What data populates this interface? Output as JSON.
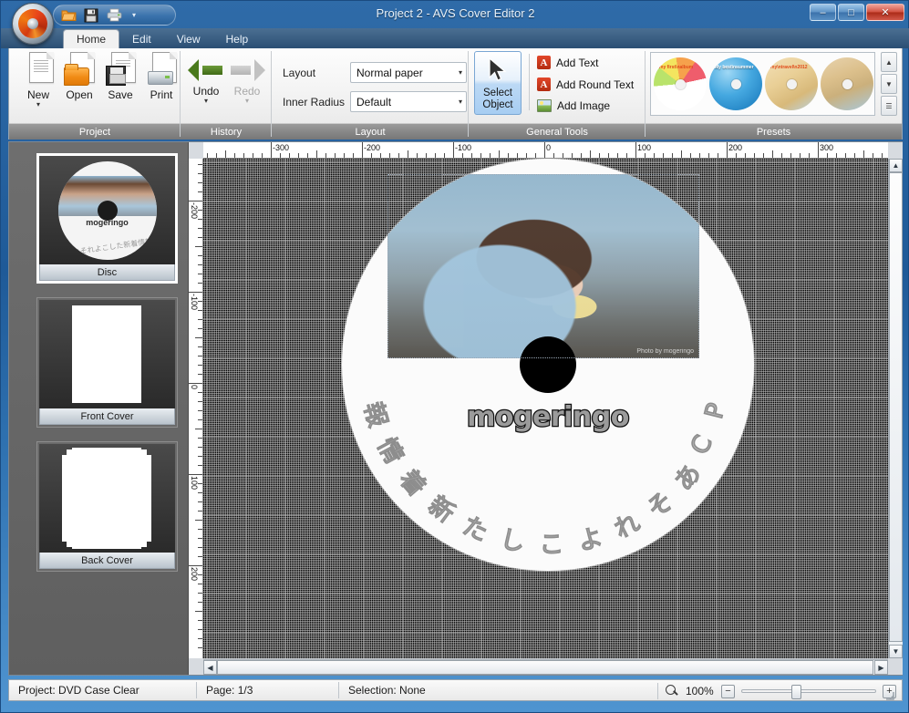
{
  "window": {
    "title": "Project 2 - AVS Cover Editor 2",
    "minimize_label": "–",
    "maximize_label": "□",
    "close_label": "✕",
    "qat_dropdown_label": "▾"
  },
  "quick_access": [
    {
      "name": "open-icon",
      "label": "Open"
    },
    {
      "name": "save-icon",
      "label": "Save"
    },
    {
      "name": "print-icon",
      "label": "Print"
    }
  ],
  "tabs": [
    {
      "label": "Home",
      "active": true
    },
    {
      "label": "Edit",
      "active": false
    },
    {
      "label": "View",
      "active": false
    },
    {
      "label": "Help",
      "active": false
    }
  ],
  "ribbon": {
    "groups": {
      "project": {
        "caption": "Project",
        "buttons": [
          {
            "label": "New",
            "caret": "▾",
            "enabled": true
          },
          {
            "label": "Open",
            "caret": "",
            "enabled": true
          },
          {
            "label": "Save",
            "caret": "",
            "enabled": true
          },
          {
            "label": "Print",
            "caret": "",
            "enabled": true
          }
        ]
      },
      "history": {
        "caption": "History",
        "buttons": [
          {
            "label": "Undo",
            "caret": "▾",
            "enabled": true
          },
          {
            "label": "Redo",
            "caret": "▾",
            "enabled": false
          }
        ]
      },
      "layout": {
        "caption": "Layout",
        "fields": [
          {
            "label": "Layout",
            "value": "Normal paper",
            "caret": "▾"
          },
          {
            "label": "Inner Radius",
            "value": "Default",
            "caret": "▾"
          }
        ]
      },
      "general_tools": {
        "caption": "General Tools",
        "select_object_label": "Select\nObject",
        "select_object_line1": "Select",
        "select_object_line2": "Object",
        "items": [
          {
            "label": "Add Text",
            "icon": "text-a-icon"
          },
          {
            "label": "Add Round Text",
            "icon": "round-text-a-icon"
          },
          {
            "label": "Add Image",
            "icon": "image-icon"
          }
        ]
      },
      "presets": {
        "caption": "Presets",
        "items": [
          {
            "name": "preset-rainbow",
            "caption": "my first\\nalbum"
          },
          {
            "name": "preset-blue",
            "caption": "My best\\nsummer"
          },
          {
            "name": "preset-travel",
            "caption": "my\\ntravel\\n2012"
          },
          {
            "name": "preset-vintage",
            "caption": ""
          }
        ],
        "scroll_up": "▲",
        "scroll_down": "▼",
        "scroll_more": "☰"
      }
    }
  },
  "sidebar": {
    "pages": [
      {
        "label": "Disc",
        "selected": true
      },
      {
        "label": "Front Cover",
        "selected": false
      },
      {
        "label": "Back Cover",
        "selected": false
      }
    ]
  },
  "canvas": {
    "ruler_h_labels": [
      "-300",
      "-200",
      "-100",
      "0",
      "100",
      "200",
      "300"
    ],
    "ruler_v_labels": [
      "-200",
      "-100",
      "0",
      "100",
      "200"
    ],
    "disc": {
      "title_text": "mogeringo",
      "round_text": "PCあそれよこした新着情報",
      "photo_watermark": "Photo by mogeringo"
    },
    "scroll": {
      "up": "▲",
      "down": "▼",
      "left": "◀",
      "right": "▶"
    }
  },
  "status": {
    "project": "Project: DVD Case Clear",
    "page": "Page: 1/3",
    "selection": "Selection: None",
    "zoom_level": "100%",
    "zoom_out_label": "−",
    "zoom_in_label": "+"
  }
}
